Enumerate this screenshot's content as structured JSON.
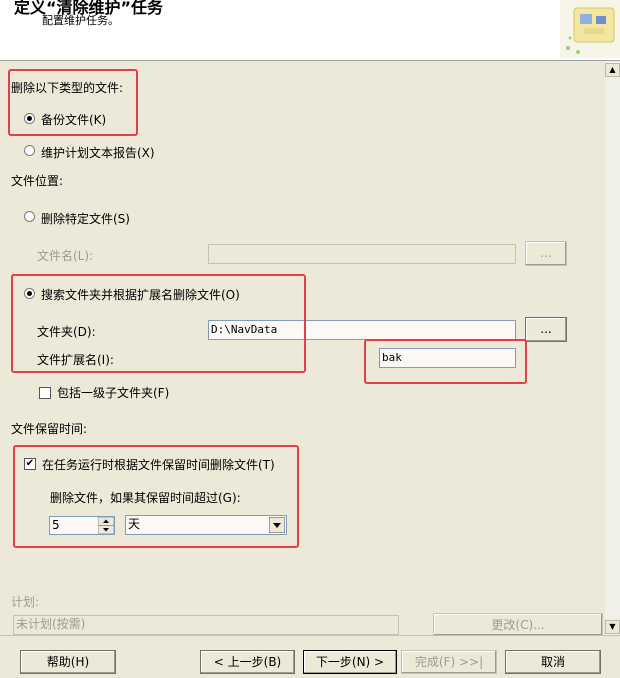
{
  "header": {
    "title": "定义“清除维护”任务",
    "subtitle": "配置维护任务。"
  },
  "delete_types": {
    "label": "删除以下类型的文件:",
    "backup_files": "备份文件(K)",
    "maintenance_report": "维护计划文本报告(X)"
  },
  "file_location": {
    "label": "文件位置:",
    "delete_specific": "删除特定文件(S)",
    "file_name_label": "文件名(L):",
    "file_name_value": "",
    "browse_label": "...",
    "search_folder": "搜索文件夹并根据扩展名删除文件(O)",
    "folder_label": "文件夹(D):",
    "folder_value": "D:\\NavData",
    "extension_label": "文件扩展名(I):",
    "extension_value": "bak",
    "include_subfolders": "包括一级子文件夹(F)"
  },
  "retention": {
    "label": "文件保留时间:",
    "delete_by_age": "在任务运行时根据文件保留时间删除文件(T)",
    "age_label": "删除文件，如果其保留时间超过(G):",
    "age_value": "5",
    "age_unit": "天"
  },
  "schedule": {
    "label": "计划:",
    "value": "未计划(按需)",
    "change_button": "更改(C)..."
  },
  "footer": {
    "help": "帮助(H)",
    "back": "< 上一步(B)",
    "next": "下一步(N) >",
    "finish": "完成(F) >>|",
    "cancel": "取消"
  },
  "icons": {
    "header_art": "maintenance-wizard-icon",
    "spinner": "spinner-arrows-icon",
    "dropdown": "chevron-down-icon",
    "scroll_up": "arrow-up-icon",
    "scroll_down": "arrow-down-icon"
  },
  "colors": {
    "highlight": "#e0404b",
    "background": "#ece9d8"
  }
}
